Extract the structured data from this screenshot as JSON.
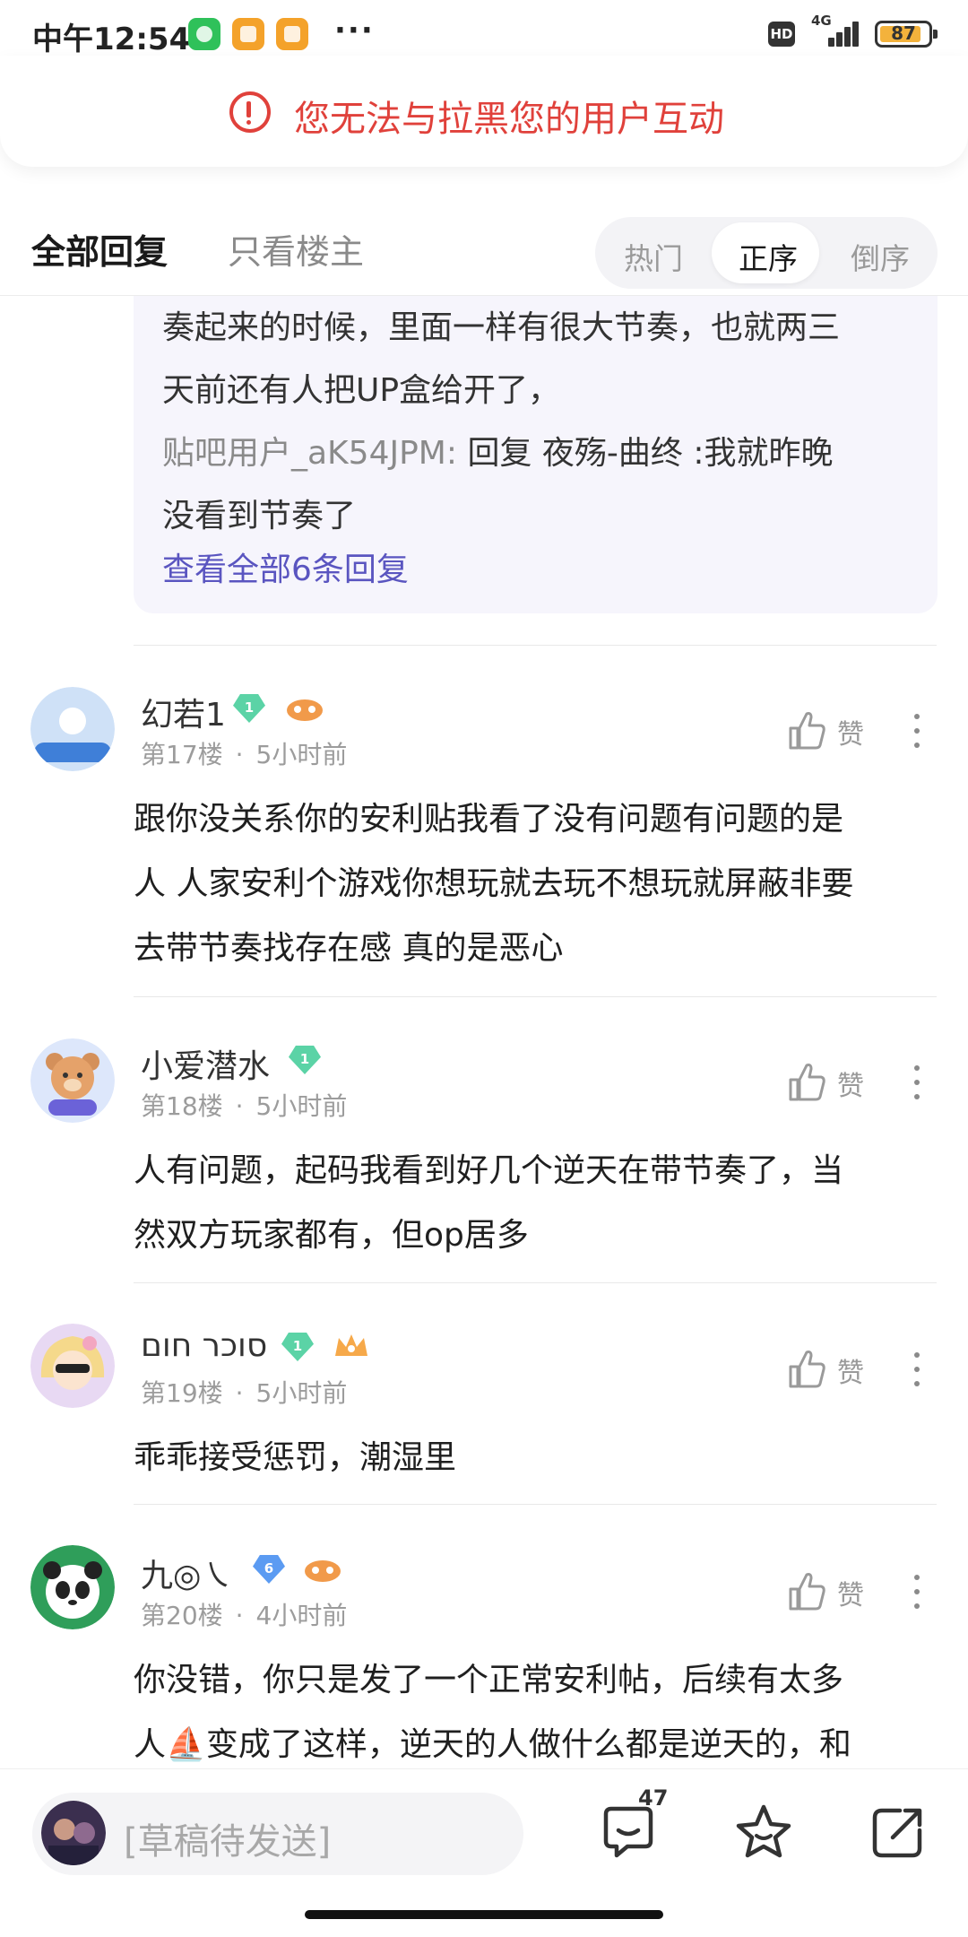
{
  "status_bar": {
    "time": "中午12:54",
    "network": "4G",
    "hd": "HD",
    "battery": "87",
    "battery_level": 0.87,
    "more": "···",
    "notification_icons": [
      "wechat-icon",
      "notes-icon",
      "notes-icon"
    ]
  },
  "toast": {
    "icon": "alert-circle-icon",
    "message": "您无法与拉黑您的用户互动",
    "color": "#e0413b"
  },
  "reply_filter": {
    "all_replies": "全部回复",
    "op_only": "只看楼主",
    "sort": {
      "hot": "热门",
      "ascending": "正序",
      "descending": "倒序",
      "selected": "正序"
    }
  },
  "sub_replies": {
    "line1": "奏起来的时候，里面一样有很大节奏，也就两三",
    "line2": "天前还有人把UP盒给开了，",
    "reply_user": "贴吧用户_aK54JPM:",
    "reply_line3_rest": " 回复 夜殇-曲终 :我就昨晚",
    "line4": "没看到节奏了",
    "view_all": "查看全部6条回复"
  },
  "comments": [
    {
      "username": "幻若1",
      "level": "1",
      "floor": "第17楼",
      "time": "5小时前",
      "like_label": "赞",
      "lines": [
        "跟你没关系你的安利贴我看了没有问题有问题的是",
        "人 人家安利个游戏你想玩就去玩不想玩就屏蔽非要",
        "去带节奏找存在感 真的是恶心"
      ]
    },
    {
      "username": "小爱潜水",
      "level": "1",
      "floor": "第18楼",
      "time": "5小时前",
      "like_label": "赞",
      "lines": [
        "人有问题，起码我看到好几个逆天在带节奏了，当",
        "然双方玩家都有，但op居多"
      ]
    },
    {
      "username": "סוכר חום",
      "level": "1",
      "floor": "第19楼",
      "time": "5小时前",
      "like_label": "赞",
      "lines": [
        "乖乖接受惩罚，潮湿里"
      ]
    },
    {
      "username": "九◎㇏",
      "level": "6",
      "floor": "第20楼",
      "time": "4小时前",
      "like_label": "赞",
      "lines": [
        "你没错，你只是发了一个正常安利帖，后续有太多",
        "人⛵变成了这样，逆天的人做什么都是逆天的，和"
      ]
    }
  ],
  "bottom_bar": {
    "draft_placeholder": "[草稿待发送]",
    "comment_count": "47",
    "icons": [
      "comment-icon",
      "star-icon",
      "share-icon"
    ]
  }
}
